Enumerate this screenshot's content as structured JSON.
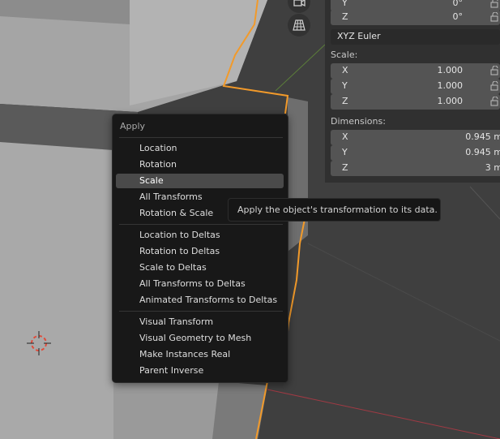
{
  "viewport": {
    "icons": [
      "camera-icon",
      "grid-view-icon",
      "3d-cursor-icon"
    ],
    "colors": {
      "selection_outline": "#f29a2a",
      "x_axis": "#a03a44",
      "y_axis": "#5b7d3a"
    }
  },
  "properties": {
    "rotation": {
      "y": "0°",
      "z": "0°"
    },
    "rotation_mode": "XYZ Euler",
    "scale_label": "Scale:",
    "scale": {
      "x": "1.000",
      "y": "1.000",
      "z": "1.000"
    },
    "dimensions_label": "Dimensions:",
    "dimensions": {
      "x": "0.945 m",
      "y": "0.945 m",
      "z": "3 m"
    },
    "axes": {
      "x": "X",
      "y": "Y",
      "z": "Z"
    }
  },
  "menu": {
    "title": "Apply",
    "items": [
      {
        "label": "Location"
      },
      {
        "label": "Rotation"
      },
      {
        "label": "Scale",
        "active": true
      },
      {
        "label": "All Transforms"
      },
      {
        "label": "Rotation & Scale"
      },
      {
        "label": "Location to Deltas"
      },
      {
        "label": "Rotation to Deltas"
      },
      {
        "label": "Scale to Deltas"
      },
      {
        "label": "All Transforms to Deltas"
      },
      {
        "label": "Animated Transforms to Deltas"
      },
      {
        "label": "Visual Transform"
      },
      {
        "label": "Visual Geometry to Mesh"
      },
      {
        "label": "Make Instances Real"
      },
      {
        "label": "Parent Inverse"
      }
    ]
  },
  "tooltip": {
    "text": "Apply the object's transformation to its data."
  }
}
